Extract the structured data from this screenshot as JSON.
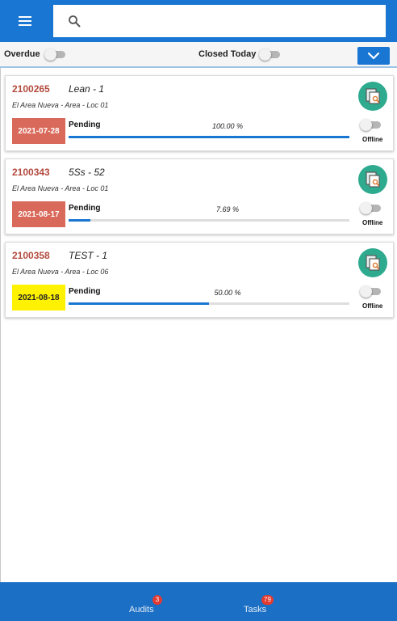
{
  "header": {
    "menu_icon": "hamburger-menu-icon",
    "search_icon": "search-icon",
    "search_value": "",
    "search_placeholder": "",
    "colors": {
      "bar": "#1976d2"
    }
  },
  "filters": {
    "overdue_label": "Overdue",
    "overdue_on": false,
    "closed_today_label": "Closed Today",
    "closed_today_on": false,
    "dropdown_icon": "chevron-down-icon"
  },
  "audits": [
    {
      "id": "2100265",
      "name": "Lean - 1",
      "area": "El Area Nueva - Area - Loc 01",
      "date": "2021-07-28",
      "date_color": "#d9695a",
      "status": "Pending",
      "percent_text": "100.00 %",
      "progress": 100,
      "action_icon": "clipboard-search-icon",
      "offline_label": "Offline",
      "offline_on": false
    },
    {
      "id": "2100343",
      "name": "5Ss - 52",
      "area": "El Area Nueva - Area - Loc 01",
      "date": "2021-08-17",
      "date_color": "#d9695a",
      "status": "Pending",
      "percent_text": "7.69 %",
      "progress": 7.69,
      "action_icon": "clipboard-search-icon",
      "offline_label": "Offline",
      "offline_on": false
    },
    {
      "id": "2100358",
      "name": "TEST - 1",
      "area": "El Area Nueva - Area - Loc 06",
      "date": "2021-08-18",
      "date_color": "#fff200",
      "status": "Pending",
      "percent_text": "50.00 %",
      "progress": 50,
      "action_icon": "clipboard-search-icon",
      "offline_label": "Offline",
      "offline_on": false
    }
  ],
  "bottom_nav": {
    "audits_label": "Audits",
    "audits_badge": "3",
    "tasks_label": "Tasks",
    "tasks_badge": "79",
    "color": "#1b6fc5"
  }
}
